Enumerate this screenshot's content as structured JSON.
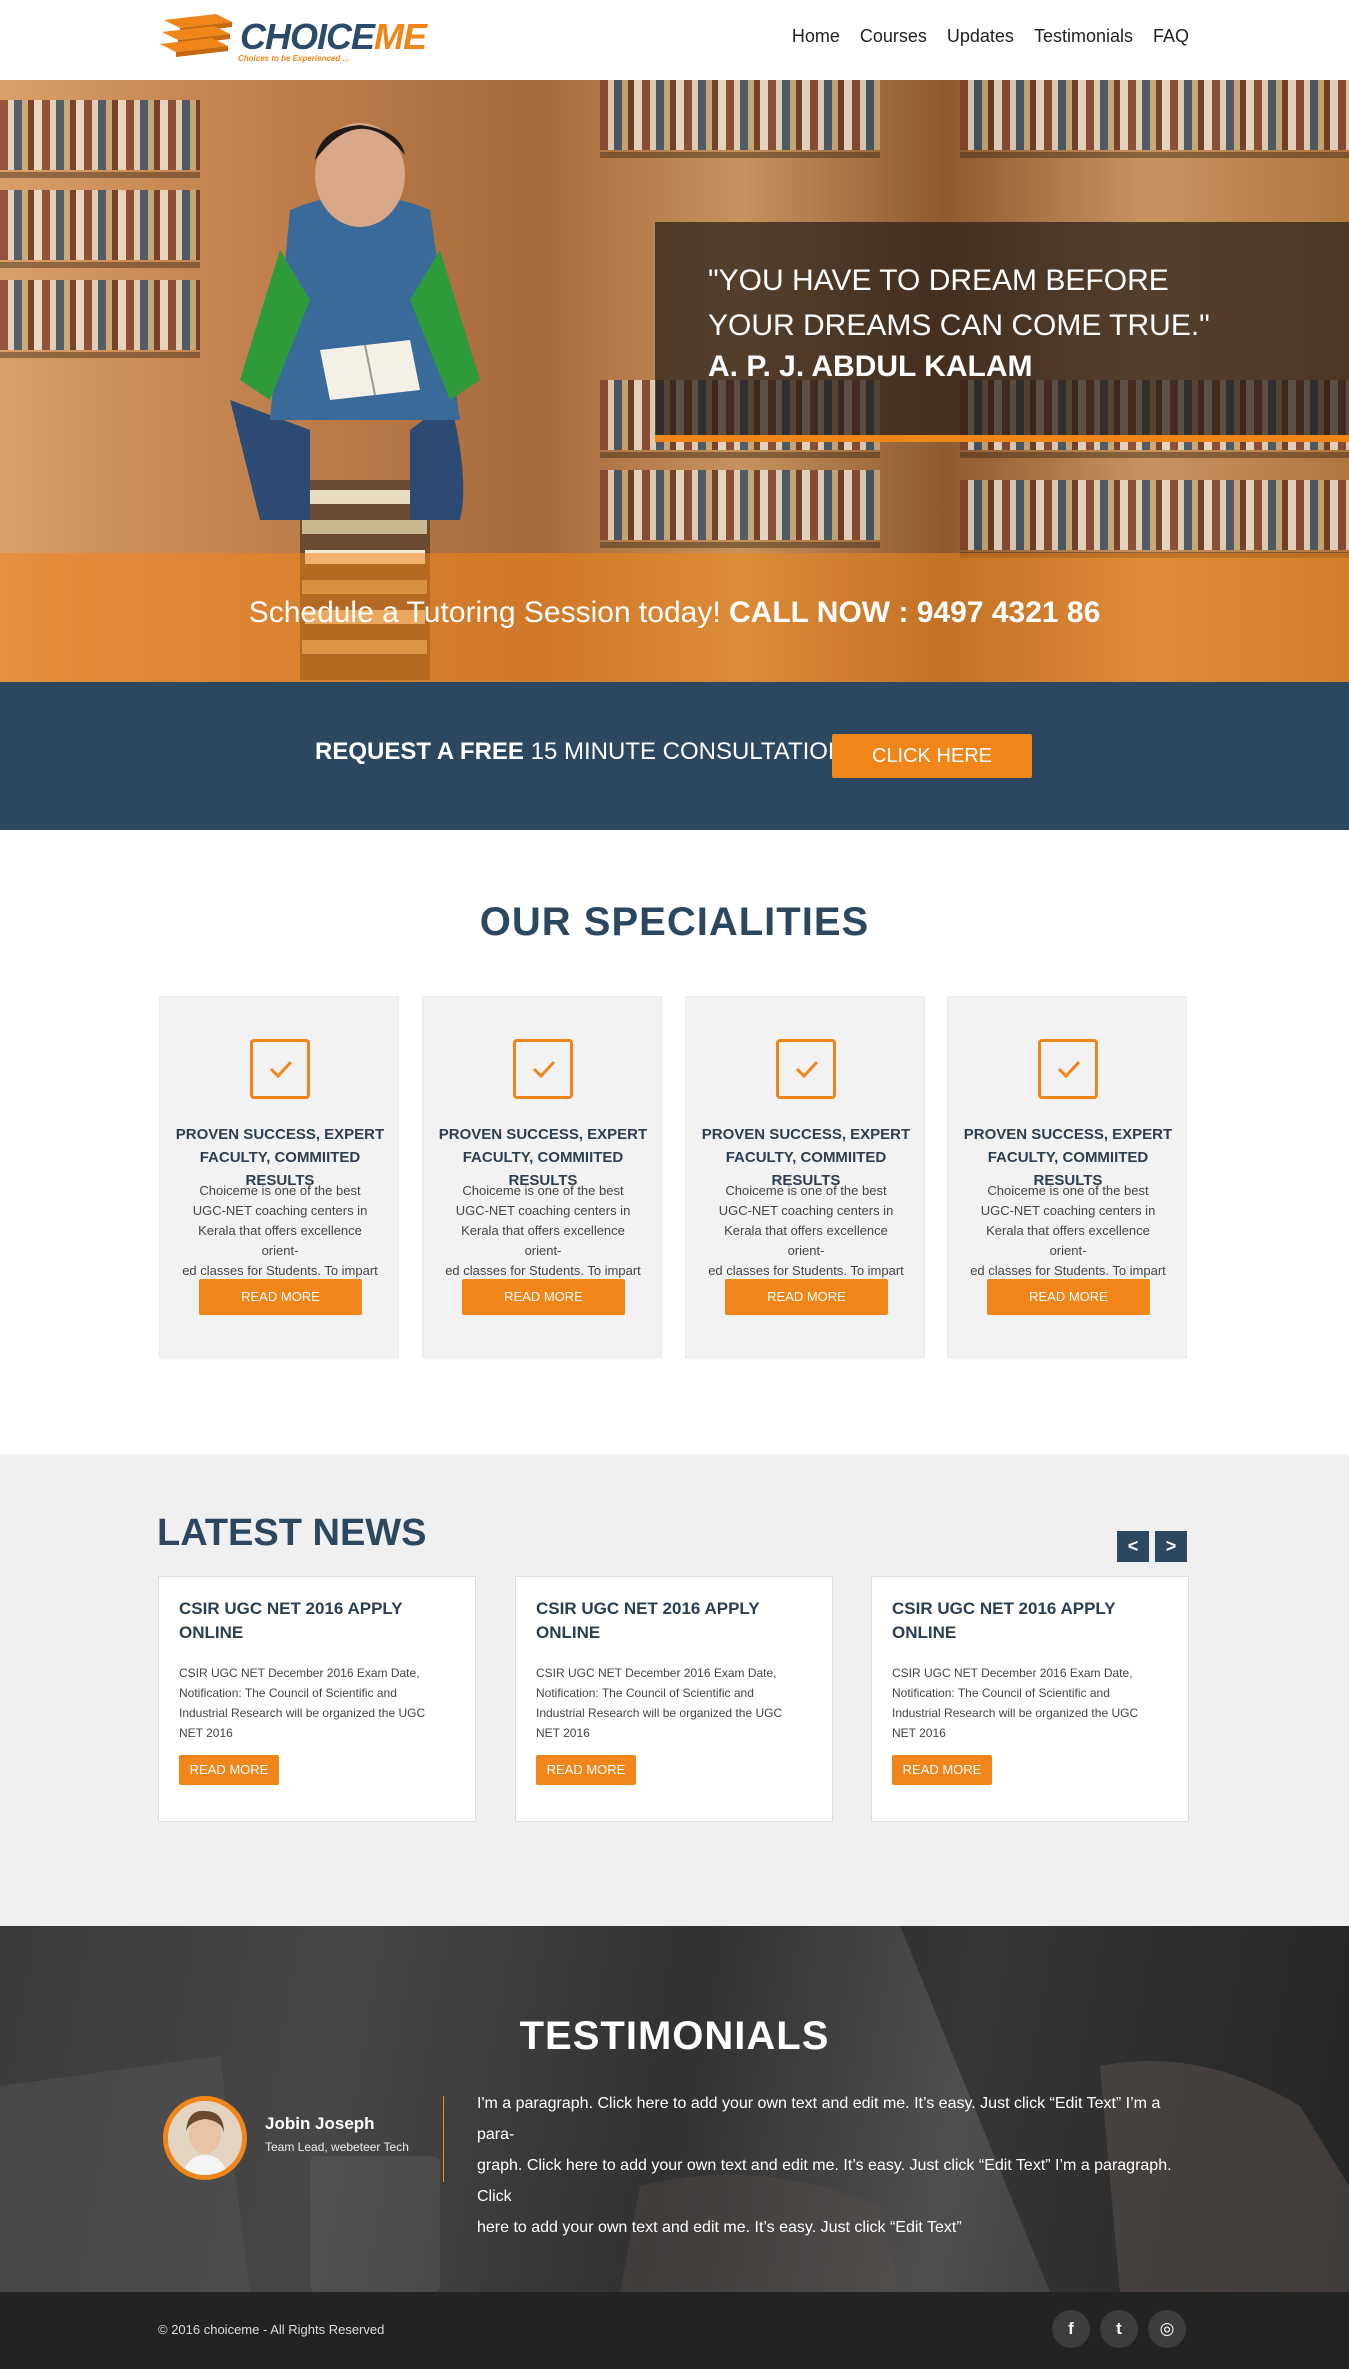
{
  "header": {
    "logo_word1": "CHOICE",
    "logo_word2": "ME",
    "logo_tagline": "Choices to be Experienced ...",
    "nav": [
      "Home",
      "Courses",
      "Updates",
      "Testimonials",
      "FAQ"
    ]
  },
  "hero": {
    "quote_line1": "\"YOU HAVE TO DREAM BEFORE",
    "quote_line2": "YOUR DREAMS CAN COME TRUE.\"",
    "quote_author": "A. P. J. ABDUL KALAM",
    "schedule_text": "Schedule a Tutoring Session today!",
    "call_label": "CALL NOW :",
    "phone": "9497 4321 86"
  },
  "consultation": {
    "bold": "REQUEST A FREE",
    "light": "15 MINUTE CONSULTATION",
    "button": "CLICK HERE"
  },
  "specialities": {
    "title": "OUR SPECIALITIES",
    "cards": [
      {
        "heading_l1": "PROVEN SUCCESS, EXPERT",
        "heading_l2": "FACULTY, COMMIITED RESULTS",
        "body_l1": "Choiceme is one of the best",
        "body_l2": "UGC-NET coaching centers in",
        "body_l3": "Kerala that offers excellence orient-",
        "body_l4": "ed classes for Students. To impart",
        "button": "READ MORE"
      },
      {
        "heading_l1": "PROVEN SUCCESS, EXPERT",
        "heading_l2": "FACULTY, COMMIITED RESULTS",
        "body_l1": "Choiceme is one of the best",
        "body_l2": "UGC-NET coaching centers in",
        "body_l3": "Kerala that offers excellence orient-",
        "body_l4": "ed classes for Students. To impart",
        "button": "READ MORE"
      },
      {
        "heading_l1": "PROVEN SUCCESS, EXPERT",
        "heading_l2": "FACULTY, COMMIITED RESULTS",
        "body_l1": "Choiceme is one of the best",
        "body_l2": "UGC-NET coaching centers in",
        "body_l3": "Kerala that offers excellence orient-",
        "body_l4": "ed classes for Students. To impart",
        "button": "READ MORE"
      },
      {
        "heading_l1": "PROVEN SUCCESS, EXPERT",
        "heading_l2": "FACULTY, COMMIITED RESULTS",
        "body_l1": "Choiceme is one of the best",
        "body_l2": "UGC-NET coaching centers in",
        "body_l3": "Kerala that offers excellence orient-",
        "body_l4": "ed classes for Students. To impart",
        "button": "READ MORE"
      }
    ]
  },
  "news": {
    "title": "LATEST NEWS",
    "prev": "<",
    "next": ">",
    "cards": [
      {
        "title_l1": "CSIR UGC NET 2016  APPLY",
        "title_l2": "ONLINE",
        "body_l1": "CSIR UGC NET December 2016 Exam Date,",
        "body_l2": "Notification: The Council of Scientific and",
        "body_l3": "Industrial Research will be organized the UGC",
        "body_l4": "NET 2016",
        "button": "READ MORE"
      },
      {
        "title_l1": "CSIR UGC NET 2016  APPLY",
        "title_l2": "ONLINE",
        "body_l1": "CSIR UGC NET December 2016 Exam Date,",
        "body_l2": "Notification: The Council of Scientific and",
        "body_l3": "Industrial Research will be organized the UGC",
        "body_l4": "NET 2016",
        "button": "READ MORE"
      },
      {
        "title_l1": "CSIR UGC NET 2016  APPLY",
        "title_l2": "ONLINE",
        "body_l1": "CSIR UGC NET December 2016 Exam Date,",
        "body_l2": "Notification: The Council of Scientific and",
        "body_l3": "Industrial Research will be organized the UGC",
        "body_l4": "NET 2016",
        "button": "READ MORE"
      }
    ]
  },
  "testimonials": {
    "title": "TESTIMONIALS",
    "name": "Jobin Joseph",
    "role": "Team Lead, webeteer Tech",
    "quote_l1": "I'm a paragraph. Click here to add your own text and edit me. It’s easy. Just click “Edit Text” I’m a para-",
    "quote_l2": "graph. Click here to add your own text and edit me. It’s easy. Just click “Edit Text” I’m a paragraph. Click",
    "quote_l3": "here to add your own text and edit me. It’s easy. Just click “Edit Text”"
  },
  "footer": {
    "copyright": "© 2016 choiceme - All Rights Reserved",
    "social": [
      {
        "icon": "facebook-icon",
        "glyph": "f"
      },
      {
        "icon": "twitter-icon",
        "glyph": "t"
      },
      {
        "icon": "instagram-icon",
        "glyph": "◎"
      }
    ]
  },
  "colors": {
    "accent": "#f08519",
    "navy": "#2c4860",
    "footer": "#232323"
  }
}
